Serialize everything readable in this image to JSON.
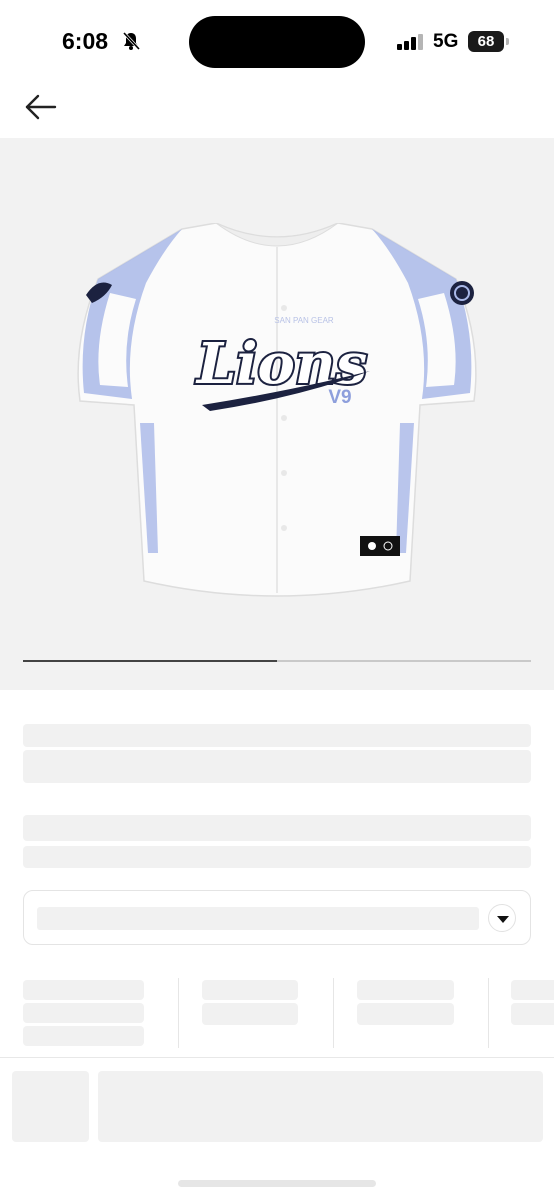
{
  "status_bar": {
    "time": "6:08",
    "network": "5G",
    "battery": "68",
    "icons": [
      "bell-muted-icon",
      "signal-bars-icon",
      "battery-icon"
    ]
  },
  "nav": {
    "back_icon": "arrow-left-icon"
  },
  "product_image": {
    "jersey_wordmark": "Lions",
    "jersey_small_text": "SAN PAN GEAR",
    "jersey_mark": "V9",
    "gallery_progress": 0.5
  },
  "options": {
    "dropdown_icon": "triangle-down-icon"
  },
  "colors": {
    "hero_background": "#f2f2f2",
    "skeleton": "#f1f1f1",
    "jersey_accent": "#a9b8e8",
    "jersey_navy": "#1c2240"
  }
}
